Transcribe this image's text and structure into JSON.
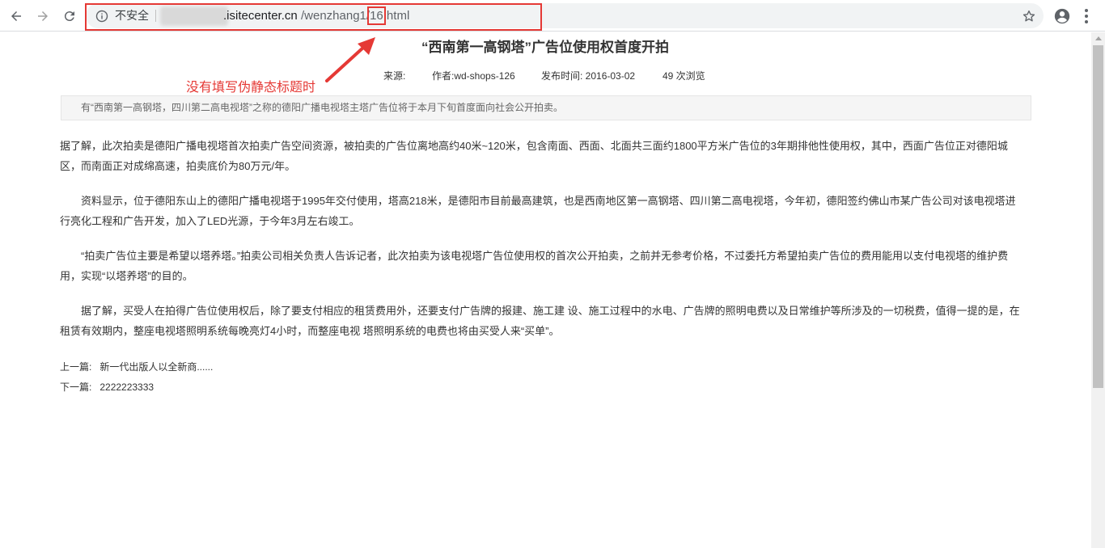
{
  "browser": {
    "security_label": "不安全",
    "url_host": ".isitecenter.cn",
    "url_path_prefix": "/wenzhang1/",
    "url_path_highlight": "16",
    "url_path_suffix": ".html"
  },
  "article": {
    "title": "“西南第一高钢塔”广告位使用权首度开拍",
    "meta": {
      "source_label": "来源:",
      "author": "作者:wd-shops-126",
      "date": "发布时间: 2016-03-02",
      "views": "49 次浏览"
    },
    "summary": "有“西南第一高钢塔，四川第二高电视塔”之称的德阳广播电视塔主塔广告位将于本月下旬首度面向社会公开拍卖。",
    "paragraphs": [
      " 据了解，此次拍卖是德阳广播电视塔首次拍卖广告空间资源，被拍卖的广告位离地高约40米~120米，包含南面、西面、北面共三面约1800平方米广告位的3年期排他性使用权，其中，西面广告位正对德阳城区，而南面正对成绵高速，拍卖底价为80万元/年。",
      "　　资料显示，位于德阳东山上的德阳广播电视塔于1995年交付使用，塔高218米，是德阳市目前最高建筑，也是西南地区第一高钢塔、四川第二高电视塔，今年初，德阳签约佛山市某广告公司对该电视塔进行亮化工程和广告开发，加入了LED光源，于今年3月左右竣工。",
      "　　“拍卖广告位主要是希望以塔养塔。”拍卖公司相关负责人告诉记者，此次拍卖为该电视塔广告位使用权的首次公开拍卖，之前并无参考价格，不过委托方希望拍卖广告位的费用能用以支付电视塔的维护费用，实现“以塔养塔”的目的。",
      "　　据了解，买受人在拍得广告位使用权后，除了要支付相应的租赁费用外，还要支付广告牌的报建、施工建 设、施工过程中的水电、广告牌的照明电费以及日常维护等所涉及的一切税费，值得一提的是，在租赁有效期内，整座电视塔照明系统每晚亮灯4小时，而整座电视 塔照明系统的电费也将由买受人来“买单”。"
    ],
    "prev_label": "上一篇:",
    "prev_title": "新一代出版人以全新商......",
    "next_label": "下一篇:",
    "next_title": "2222223333"
  },
  "annotation": {
    "text": "没有填写伪静态标题时",
    "color": "#e53935"
  }
}
